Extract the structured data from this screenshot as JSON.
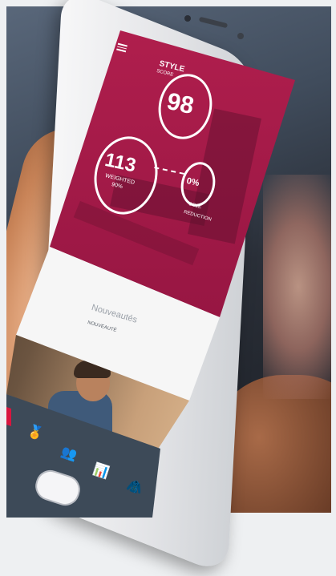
{
  "app": {
    "style_score": {
      "label_line1": "STYLE",
      "label_line2": "SCORE",
      "value": "98"
    },
    "items": {
      "value": "113",
      "label_line1": "WEIGHTED",
      "label_line2": "90%"
    },
    "reduction": {
      "value": "0%",
      "label_line1": "CO2E",
      "label_line2": "REDUCTION"
    },
    "section_title": "Nouveautés",
    "section_subtitle": "NOUVEAUTÉ"
  },
  "nav": {
    "items": [
      {
        "name": "award-icon",
        "glyph": "🏅"
      },
      {
        "name": "community-icon",
        "glyph": "👥"
      },
      {
        "name": "stats-icon",
        "glyph": "📊"
      },
      {
        "name": "wardrobe-icon",
        "glyph": "🧥"
      }
    ]
  },
  "colors": {
    "hero": "#a81a48",
    "nav": "#3d4a58",
    "accent": "#d8163f"
  }
}
